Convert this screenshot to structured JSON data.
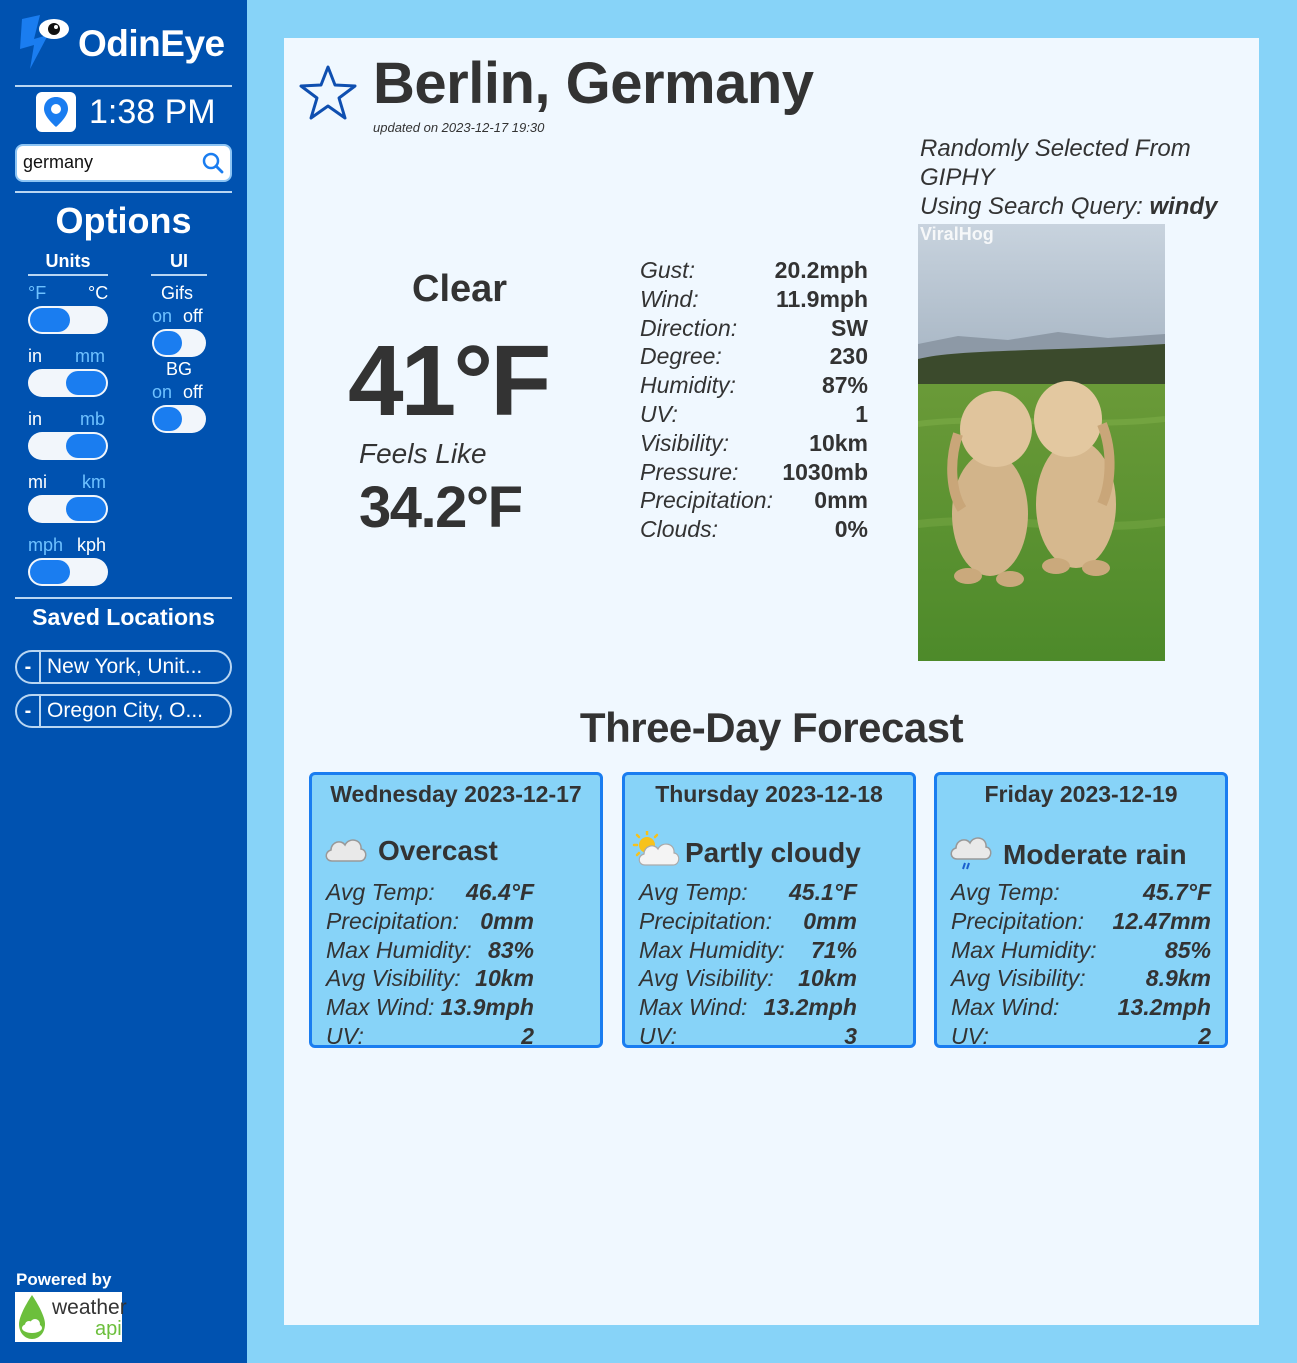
{
  "app": {
    "name": "OdinEye"
  },
  "clock": {
    "time": "1:38 PM"
  },
  "search": {
    "value": "germany",
    "placeholder": ""
  },
  "options": {
    "title": "Options",
    "units_heading": "Units",
    "ui_heading": "UI",
    "units": [
      {
        "left": "°F",
        "right": "°C",
        "selected": "°F"
      },
      {
        "left": "in",
        "right": "mm",
        "selected": "mm"
      },
      {
        "left": "in",
        "right": "mb",
        "selected": "mb"
      },
      {
        "left": "mi",
        "right": "km",
        "selected": "km"
      },
      {
        "left": "mph",
        "right": "kph",
        "selected": "mph"
      }
    ],
    "ui": [
      {
        "label": "Gifs",
        "on": "on",
        "off": "off",
        "selected": "on"
      },
      {
        "label": "BG",
        "on": "on",
        "off": "off",
        "selected": "on"
      }
    ]
  },
  "saved": {
    "title": "Saved Locations",
    "remove_label": "-",
    "items": [
      "New York, Unit...",
      "Oregon City, O..."
    ]
  },
  "footer": {
    "powered_by": "Powered by",
    "logo_text_1": "weather",
    "logo_text_2": "api"
  },
  "current": {
    "city": "Berlin, Germany",
    "updated": "updated on 2023-12-17 19:30",
    "condition": "Clear",
    "condition_icon": "moon-icon",
    "temp": "41°F",
    "feels_like_label": "Feels Like",
    "feels_like": "34.2°F",
    "stats": [
      {
        "label": "Gust:",
        "value": "20.2mph"
      },
      {
        "label": "Wind:",
        "value": "11.9mph"
      },
      {
        "label": "Direction:",
        "value": "SW"
      },
      {
        "label": "Degree:",
        "value": "230"
      },
      {
        "label": "Humidity:",
        "value": "87%"
      },
      {
        "label": "UV:",
        "value": "1"
      },
      {
        "label": "Visibility:",
        "value": "10km"
      },
      {
        "label": "Pressure:",
        "value": "1030mb"
      },
      {
        "label": "Precipitation:",
        "value": "0mm"
      },
      {
        "label": "Clouds:",
        "value": "0%"
      }
    ]
  },
  "giphy": {
    "line1": "Randomly Selected From",
    "line2": "GIPHY",
    "line3_prefix": "Using Search Query: ",
    "query": "windy",
    "watermark": "ViralHog"
  },
  "forecast": {
    "title": "Three-Day Forecast",
    "days": [
      {
        "day": "Wednesday",
        "date": "2023-12-17",
        "condition": "Overcast",
        "icon": "cloud-icon",
        "stats": [
          {
            "label": "Avg Temp:",
            "value": "46.4°F"
          },
          {
            "label": "Precipitation:",
            "value": "0mm"
          },
          {
            "label": "Max Humidity:",
            "value": "83%"
          },
          {
            "label": "Avg Visibility:",
            "value": "10km"
          },
          {
            "label": "Max Wind:",
            "value": "13.9mph"
          },
          {
            "label": "UV:",
            "value": "2"
          }
        ]
      },
      {
        "day": "Thursday",
        "date": "2023-12-18",
        "condition": "Partly cloudy",
        "icon": "partly-cloudy-icon",
        "stats": [
          {
            "label": "Avg Temp:",
            "value": "45.1°F"
          },
          {
            "label": "Precipitation:",
            "value": "0mm"
          },
          {
            "label": "Max Humidity:",
            "value": "71%"
          },
          {
            "label": "Avg Visibility:",
            "value": "10km"
          },
          {
            "label": "Max Wind:",
            "value": "13.2mph"
          },
          {
            "label": "UV:",
            "value": "3"
          }
        ]
      },
      {
        "day": "Friday",
        "date": "2023-12-19",
        "condition": "Moderate rain",
        "icon": "rain-cloud-icon",
        "stats": [
          {
            "label": "Avg Temp:",
            "value": "45.7°F"
          },
          {
            "label": "Precipitation:",
            "value": "12.47mm"
          },
          {
            "label": "Max Humidity:",
            "value": "85%"
          },
          {
            "label": "Avg Visibility:",
            "value": "8.9km"
          },
          {
            "label": "Max Wind:",
            "value": "13.2mph"
          },
          {
            "label": "UV:",
            "value": "2"
          }
        ]
      }
    ]
  },
  "colors": {
    "sidebar": "#0052b0",
    "page_bg": "#87d3f8",
    "panel": "#f0f8ff",
    "accent": "#1a7df0"
  }
}
